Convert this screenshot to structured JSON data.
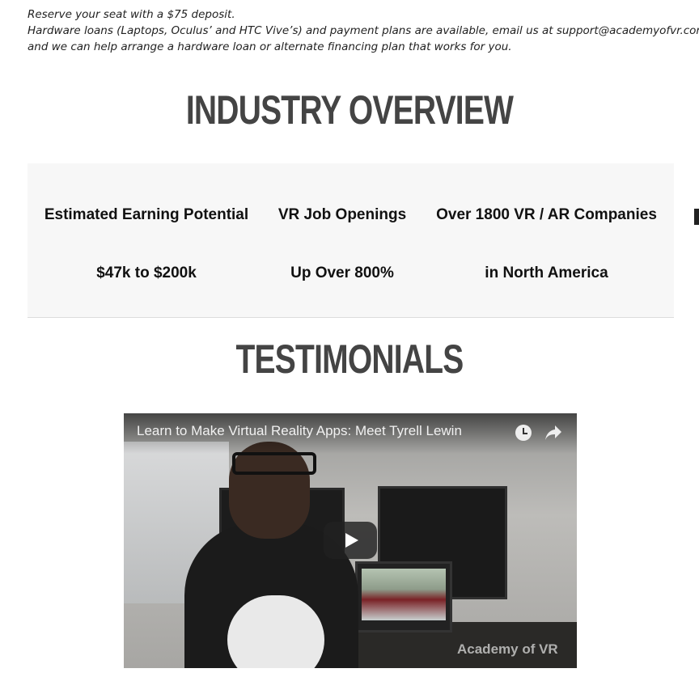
{
  "intro": {
    "line1": "Reserve your seat with a $75 deposit.",
    "line2": "Hardware loans (Laptops, Oculus’ and HTC Vive’s) and payment plans are available, email us at support@academyofvr.com",
    "line3": "and we can help arrange a hardware loan or alternate financing plan that works for you."
  },
  "industry": {
    "title": "INDUSTRY OVERVIEW",
    "stats": [
      {
        "label": "Estimated Earning Potential",
        "value": "$47k to $200k"
      },
      {
        "label": "VR Job Openings",
        "value": "Up Over 800%"
      },
      {
        "label": "Over 1800 VR / AR Companies",
        "value": "in North America"
      }
    ]
  },
  "testimonials": {
    "title": "TESTIMONIALS",
    "video": {
      "title": "Learn to Make Virtual Reality Apps: Meet Tyrell Lewin",
      "watermark": "Academy of VR",
      "icons": [
        "clock-icon",
        "share-icon",
        "play-icon"
      ]
    }
  }
}
